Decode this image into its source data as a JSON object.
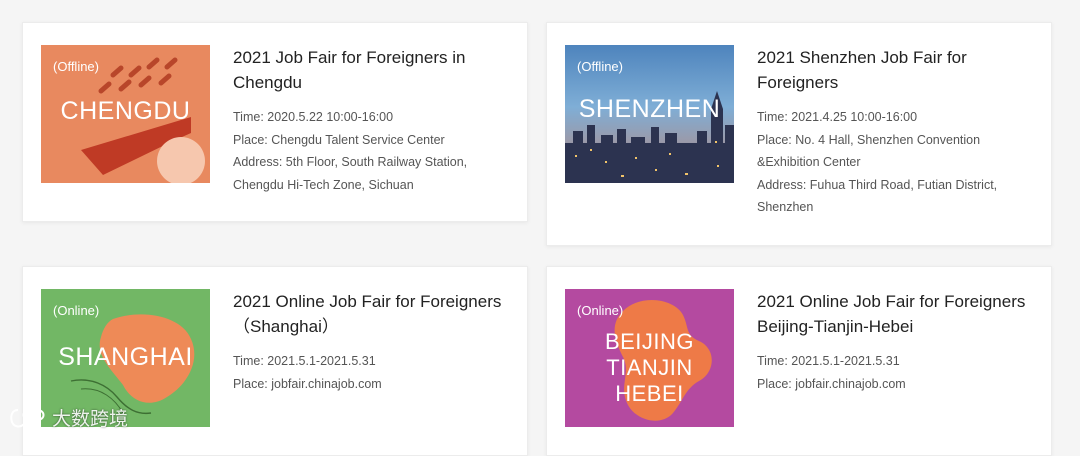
{
  "fairs": [
    {
      "tag": "(Offline)",
      "city_lines": [
        "CHENGDU"
      ],
      "title": "2021 Job Fair for Foreigners in Chengdu",
      "lines": [
        "Time: 2020.5.22 10:00-16:00",
        "Place: Chengdu Talent Service Center",
        "Address: 5th Floor, South Railway Station,",
        "Chengdu Hi-Tech Zone, Sichuan"
      ]
    },
    {
      "tag": "(Offline)",
      "city_lines": [
        "SHENZHEN"
      ],
      "title": "2021 Shenzhen Job Fair for Foreigners",
      "lines": [
        "Time: 2021.4.25 10:00-16:00",
        "Place: No. 4 Hall, Shenzhen Convention",
        "&Exhibition Center",
        "Address: Fuhua Third Road, Futian District,",
        "Shenzhen"
      ]
    },
    {
      "tag": "(Online)",
      "city_lines": [
        "SHANGHAI"
      ],
      "title": "2021 Online Job Fair for Foreigners （Shanghai）",
      "lines": [
        "Time: 2021.5.1-2021.5.31",
        "Place: jobfair.chinajob.com"
      ]
    },
    {
      "tag": "(Online)",
      "city_lines": [
        "BEIJING",
        "TIANJIN",
        "HEBEI"
      ],
      "title": "2021 Online Job Fair for Foreigners Beijing-Tianjin-Hebei",
      "lines": [
        "Time: 2021.5.1-2021.5.31",
        "Place: jobfair.chinajob.com"
      ]
    }
  ],
  "watermark": {
    "text": "大数跨境",
    "icon": "logo-icon"
  },
  "colors": {
    "chengdu_bg": "#e8895f",
    "chengdu_shape": "#bf3a25",
    "chengdu_circle": "#f6c7ae",
    "shanghai_bg": "#72b765",
    "shanghai_shape": "#ee8a57",
    "beijing_bg": "#b44aa0",
    "beijing_shape": "#ee7a47",
    "shenzhen_sky": "#6fa0cf"
  }
}
